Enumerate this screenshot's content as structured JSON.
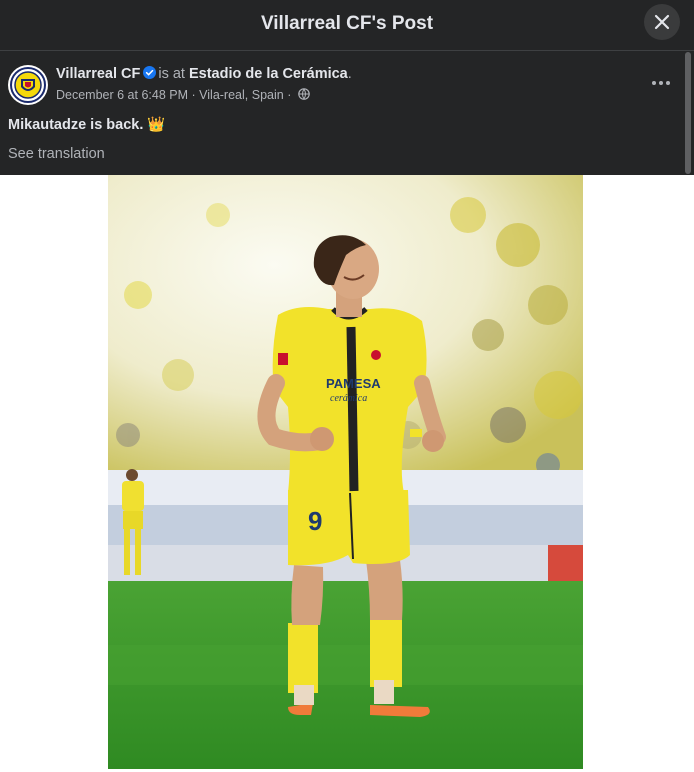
{
  "dialog": {
    "title": "Villarreal CF's Post",
    "close_icon": "close-icon"
  },
  "post": {
    "page_name": "Villarreal CF",
    "verified_icon": "verified-badge-icon",
    "is_at": "is at",
    "location": "Estadio de la Cerámica",
    "location_suffix": ".",
    "date": "December 6 at 6:48 PM",
    "separator": "·",
    "place": "Vila-real, Spain",
    "privacy_icon": "globe-icon",
    "more_icon": "more-options-icon",
    "text": "Mikautadze is back. 👑",
    "see_translation": "See translation"
  },
  "photo": {
    "jersey_sponsor": "PAMESA",
    "jersey_sponsor_sub": "cerámica",
    "jersey_number": "9"
  },
  "colors": {
    "background": "#242526",
    "text": "#e4e6eb",
    "muted": "#b0b3b8",
    "verified": "#1877f2",
    "kit_yellow": "#f2e22a",
    "pitch_green": "#3f9a2c"
  }
}
